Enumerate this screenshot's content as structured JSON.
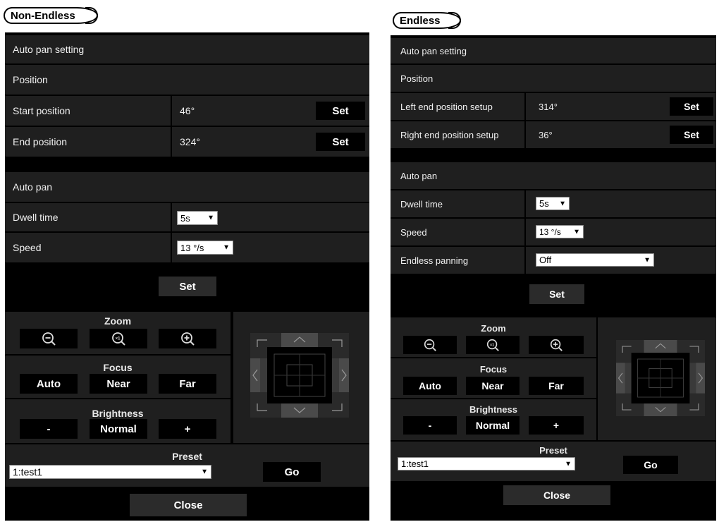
{
  "left": {
    "tag": "Non-Endless",
    "header": "Auto pan setting",
    "position_header": "Position",
    "rows": [
      {
        "label": "Start position",
        "value": "46°",
        "button": "Set"
      },
      {
        "label": "End position",
        "value": "324°",
        "button": "Set"
      }
    ],
    "autopan_header": "Auto pan",
    "dwell_label": "Dwell time",
    "dwell_value": "5s",
    "speed_label": "Speed",
    "speed_value": "13 °/s",
    "set_button": "Set",
    "zoom_label": "Zoom",
    "focus_label": "Focus",
    "focus_auto": "Auto",
    "focus_near": "Near",
    "focus_far": "Far",
    "brightness_label": "Brightness",
    "brightness_minus": "-",
    "brightness_normal": "Normal",
    "brightness_plus": "+",
    "preset_label": "Preset",
    "preset_value": "1:test1",
    "go_button": "Go",
    "close_button": "Close"
  },
  "right": {
    "tag": "Endless",
    "header": "Auto pan setting",
    "position_header": "Position",
    "rows": [
      {
        "label": "Left end position setup",
        "value": "314°",
        "button": "Set"
      },
      {
        "label": "Right end position setup",
        "value": "36°",
        "button": "Set"
      }
    ],
    "autopan_header": "Auto pan",
    "dwell_label": "Dwell time",
    "dwell_value": "5s",
    "speed_label": "Speed",
    "speed_value": "13 °/s",
    "endless_label": "Endless panning",
    "endless_value": "Off",
    "set_button": "Set",
    "zoom_label": "Zoom",
    "focus_label": "Focus",
    "focus_auto": "Auto",
    "focus_near": "Near",
    "focus_far": "Far",
    "brightness_label": "Brightness",
    "brightness_minus": "-",
    "brightness_normal": "Normal",
    "brightness_plus": "+",
    "preset_label": "Preset",
    "preset_value": "1:test1",
    "go_button": "Go",
    "close_button": "Close"
  }
}
